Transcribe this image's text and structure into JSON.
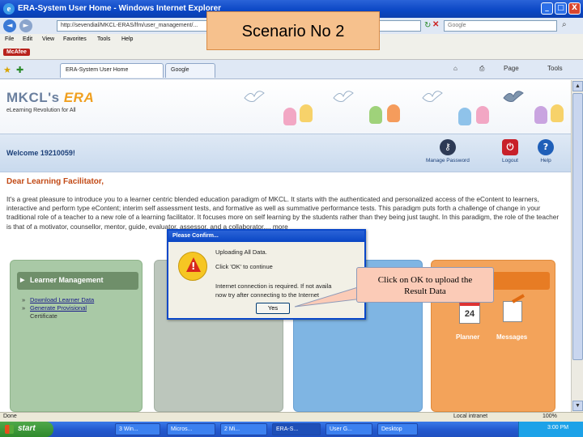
{
  "window": {
    "title": "ERA-System User Home - Windows Internet Explorer",
    "minimize": "_",
    "maximize": "□",
    "close": "X"
  },
  "address": {
    "url": "http://sevendial/MKCL-ERAS/lfm/user_management/...",
    "search_placeholder": "Google"
  },
  "menu": {
    "items": [
      "File",
      "Edit",
      "View",
      "Favorites",
      "Tools",
      "Help"
    ]
  },
  "links": {
    "mcafee": "McAfee"
  },
  "tabs": {
    "items": [
      "ERA-System User Home",
      "Google"
    ],
    "tools": [
      "Page",
      "Tools"
    ]
  },
  "banner": {
    "logo": "MKCL's ",
    "logo_era": "ERA",
    "tagline": "eLearning Revolution for All"
  },
  "header": {
    "welcome": "Welcome 19210059!",
    "manage_password": "Manage Password",
    "logout": "Logout",
    "help": "Help"
  },
  "content": {
    "greeting": "Dear Learning Facilitator,",
    "intro": "It's a great pleasure to introduce you to a learner centric blended education paradigm of MKCL. It starts with the authenticated and personalized access of the eContent to learners, interactive and perform type eContent; interim self assessment tests, and formative as well as summative performance tests. This paradigm puts forth a challenge of change in your traditional role of a teacher to a new role of a learning facilitator. It focuses more on self learning by the students rather than they being just taught. In this paradigm, the role of the teacher is that of a motivator, counsellor, mentor, guide, evaluator, assessor, and a collaborator.... more"
  },
  "panels": {
    "learner": {
      "title": "Learner Management",
      "links": [
        "Download Learner Data",
        "Generate Provisional"
      ],
      "extra": "Certificate"
    },
    "orange": {
      "title": "ion",
      "calendar_day": "24",
      "planner": "Planner",
      "messages": "Messages"
    }
  },
  "dialog": {
    "title": "Please Confirm...",
    "line1": "Uploading All Data.",
    "line2": "Click 'OK' to continue",
    "line3": "Internet connection is required. If not availa",
    "line4": "now try after connecting to the Internet",
    "yes": "Yes"
  },
  "overlay": {
    "scenario": "Scenario No 2",
    "callout_line1": "Click on OK to upload the",
    "callout_line2": "Result Data"
  },
  "status": {
    "done": "Done",
    "zone": "Local intranet",
    "zoom": "100%"
  },
  "taskbar": {
    "start": "start",
    "tasks": [
      "3 Win...",
      "Micros...",
      "2 Mi...",
      "ERA-S...",
      "User G...",
      "Desktop"
    ],
    "clock": "3:00 PM"
  },
  "colors": {
    "ie_blue": "#0a46c4",
    "greeting": "#c24a16",
    "learner_panel": "#a9c9a6",
    "orange_panel": "#f3a35a",
    "scenario_bg": "#f6c18d",
    "callout_bg": "#fbcbb7"
  }
}
